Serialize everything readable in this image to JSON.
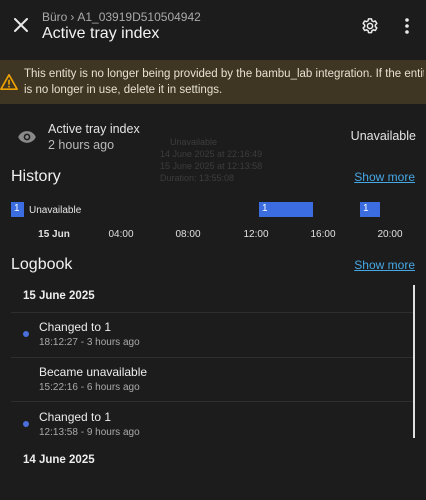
{
  "header": {
    "breadcrumb_area": "Büro",
    "breadcrumb_device": "A1_03919D510504942",
    "title": "Active tray index"
  },
  "warning": {
    "line1": "This entity is no longer being provided by the bambu_lab integration. If the entity",
    "line2": "is no longer in use, delete it in settings."
  },
  "state": {
    "name": "Active tray index",
    "last_changed": "2 hours ago",
    "value": "Unavailable"
  },
  "tooltip": {
    "line1": "Unavailable",
    "line2": "14 June 2025 at 22:16:49",
    "line3": "15 June 2025 at 12:13:58",
    "line4": "Duration: 13:55:08"
  },
  "history": {
    "title": "History",
    "show_more": "Show more",
    "state_labels": [
      "1",
      "Unavailable",
      "1",
      "1"
    ],
    "ticks": [
      "15 Jun",
      "04:00",
      "08:00",
      "12:00",
      "16:00",
      "20:00"
    ]
  },
  "logbook": {
    "title": "Logbook",
    "show_more": "Show more",
    "dates": [
      "15 June 2025",
      "14 June 2025"
    ],
    "entries": [
      {
        "title": "Changed to 1",
        "time": "18:12:27 - 3 hours ago"
      },
      {
        "title": "Became unavailable",
        "time": "15:22:16 - 6 hours ago"
      },
      {
        "title": "Changed to 1",
        "time": "12:13:58 - 9 hours ago"
      }
    ]
  },
  "colors": {
    "accent": "#3b6de0",
    "link": "#46a8e6",
    "warning_bg": "#3e3522",
    "warning_icon": "#f0a300",
    "background": "#1c1c1c"
  }
}
